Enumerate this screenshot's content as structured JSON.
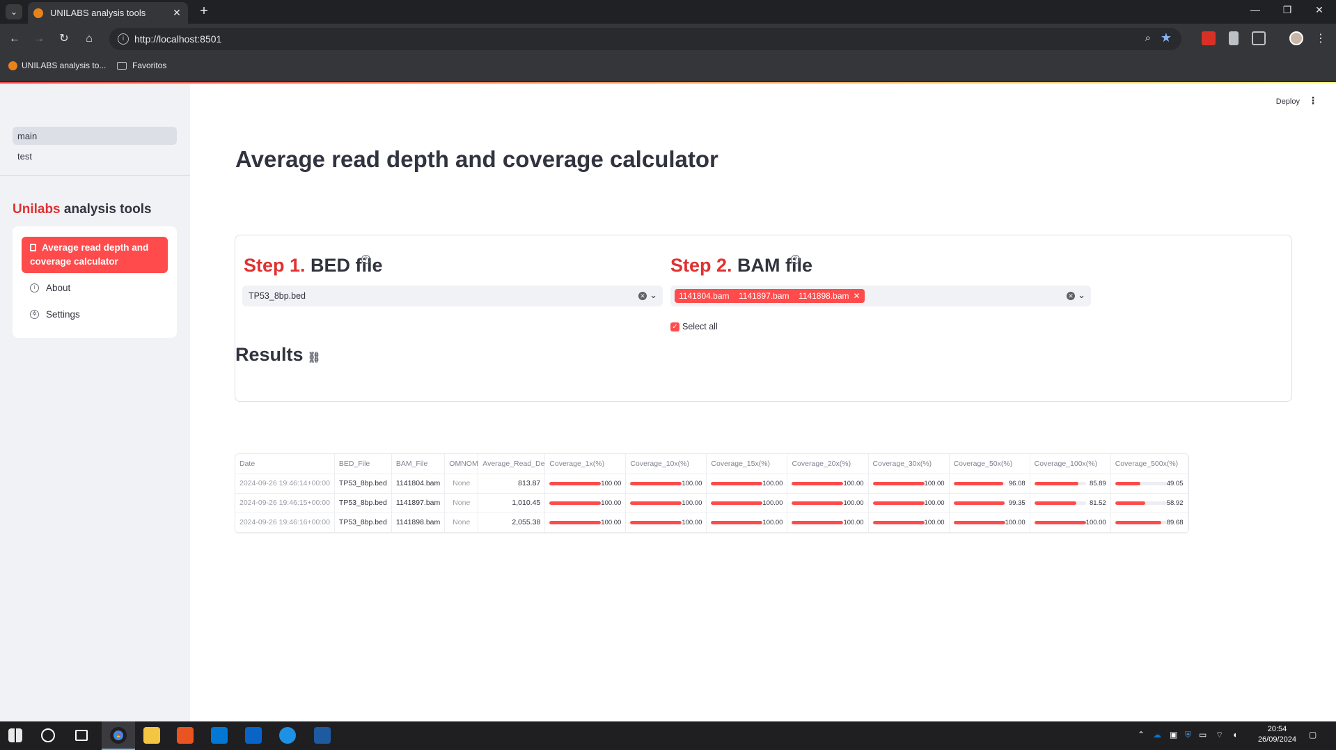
{
  "browser": {
    "tab_title": "UNILABS analysis tools",
    "url": "http://localhost:8501",
    "bookmarks": [
      {
        "label": "UNILABS analysis to..."
      },
      {
        "label": "Favoritos"
      }
    ]
  },
  "app": {
    "deploy_label": "Deploy",
    "pages": [
      {
        "label": "main",
        "active": true
      },
      {
        "label": "test",
        "active": false
      }
    ],
    "brand_accent": "Unilabs",
    "brand_rest": "analysis tools",
    "menu": [
      {
        "label": "Average read depth and coverage calculator",
        "icon": "calculator-icon",
        "active": true
      },
      {
        "label": "About",
        "icon": "info-icon",
        "active": false
      },
      {
        "label": "Settings",
        "icon": "gear-icon",
        "active": false
      }
    ],
    "accent_color": "#ff4b4b"
  },
  "main": {
    "title": "Average read depth and coverage calculator",
    "step1": {
      "num": "Step 1.",
      "label": "BED file",
      "selected": "TP53_8bp.bed"
    },
    "step2": {
      "num": "Step 2.",
      "label": "BAM file",
      "chips": [
        "1141804.bam",
        "1141897.bam",
        "1141898.bam"
      ],
      "select_all_label": "Select all",
      "select_all_checked": true
    },
    "results_title": "Results"
  },
  "table": {
    "columns": [
      "Date",
      "BED_File",
      "BAM_File",
      "OMNOMICS_",
      "Average_Read_Depth",
      "Coverage_1x(%)",
      "Coverage_10x(%)",
      "Coverage_15x(%)",
      "Coverage_20x(%)",
      "Coverage_30x(%)",
      "Coverage_50x(%)",
      "Coverage_100x(%)",
      "Coverage_500x(%)"
    ],
    "rows": [
      {
        "date": "2024-09-26 19:46:14+00:00",
        "bed": "TP53_8bp.bed",
        "bam": "1141804.bam",
        "omnomics": "None",
        "depth": "813.87",
        "cov": [
          100.0,
          100.0,
          100.0,
          100.0,
          100.0,
          96.08,
          85.89,
          49.05
        ]
      },
      {
        "date": "2024-09-26 19:46:15+00:00",
        "bed": "TP53_8bp.bed",
        "bam": "1141897.bam",
        "omnomics": "None",
        "depth": "1,010.45",
        "cov": [
          100.0,
          100.0,
          100.0,
          100.0,
          100.0,
          99.35,
          81.52,
          58.92
        ]
      },
      {
        "date": "2024-09-26 19:46:16+00:00",
        "bed": "TP53_8bp.bed",
        "bam": "1141898.bam",
        "omnomics": "None",
        "depth": "2,055.38",
        "cov": [
          100.0,
          100.0,
          100.0,
          100.0,
          100.0,
          100.0,
          100.0,
          89.68
        ]
      }
    ]
  },
  "taskbar": {
    "time": "20:54",
    "date": "26/09/2024"
  }
}
